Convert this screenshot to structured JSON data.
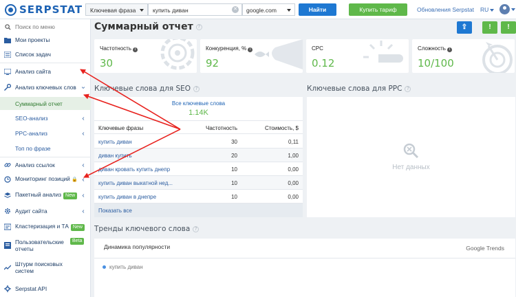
{
  "header": {
    "logo_text": "SERPSTAT",
    "query_type": "Ключевая фраза",
    "query_value": "купить диван",
    "database": "google.com",
    "find_label": "Найти",
    "buy_label": "Купить тариф",
    "updates_label": "Обновления Serpstat",
    "lang": "RU"
  },
  "sidebar": {
    "search_placeholder": "Поиск по меню",
    "my_projects": "Мои проекты",
    "task_list": "Список задач",
    "site_analysis": "Анализ сайта",
    "keyword_analysis": "Анализ ключевых слов",
    "summary_report": "Суммарный отчет",
    "seo_analysis": "SEO-анализ",
    "ppc_analysis": "PPC-анализ",
    "top_by_phrase": "Топ по фразе",
    "link_analysis": "Анализ ссылок",
    "position_monitoring": "Мониторинг позиций",
    "batch_analysis": "Пакетный анализ",
    "site_audit": "Аудит сайта",
    "clustering": "Кластеризация и ТА",
    "custom_reports": "Пользовательские отчеты",
    "search_storm": "Штурм поисковых систем",
    "api": "Serpstat API",
    "badge_new": "New",
    "badge_beta": "Beta"
  },
  "main": {
    "title": "Суммарный отчет",
    "cards": [
      {
        "label": "Частотность",
        "value": "30"
      },
      {
        "label": "Конкуренция, %",
        "value": "92"
      },
      {
        "label": "CPC",
        "value": "0.12"
      },
      {
        "label": "Сложность",
        "value": "10/100"
      }
    ],
    "seo_title": "Ключевые слова для SEO",
    "ppc_title": "Ключевые слова для PPC",
    "all_keywords_label": "Все ключевые слова",
    "all_keywords_value": "1.14K",
    "table_headers": [
      "Ключевые фразы",
      "Частотность",
      "Стоимость, $"
    ],
    "rows": [
      {
        "phrase": "купить диван",
        "freq": "30",
        "cost": "0,11"
      },
      {
        "phrase": "диван купить",
        "freq": "20",
        "cost": "1,00"
      },
      {
        "phrase": "диван кровать купить днепр",
        "freq": "10",
        "cost": "0,00"
      },
      {
        "phrase": "купить диван выкатной нед...",
        "freq": "10",
        "cost": "0,00"
      },
      {
        "phrase": "купить диван в днепре",
        "freq": "10",
        "cost": "0,00"
      }
    ],
    "show_all": "Показать все",
    "no_data": "Нет данных",
    "trends_title": "Тренды ключевого слова",
    "popularity_label": "Динамика популярности",
    "google_trends": "Google Trends",
    "legend_item": "купить диван"
  },
  "colors": {
    "accent_blue": "#1e78d2",
    "accent_green": "#5fb84a",
    "annotation_red": "#e8231f"
  }
}
